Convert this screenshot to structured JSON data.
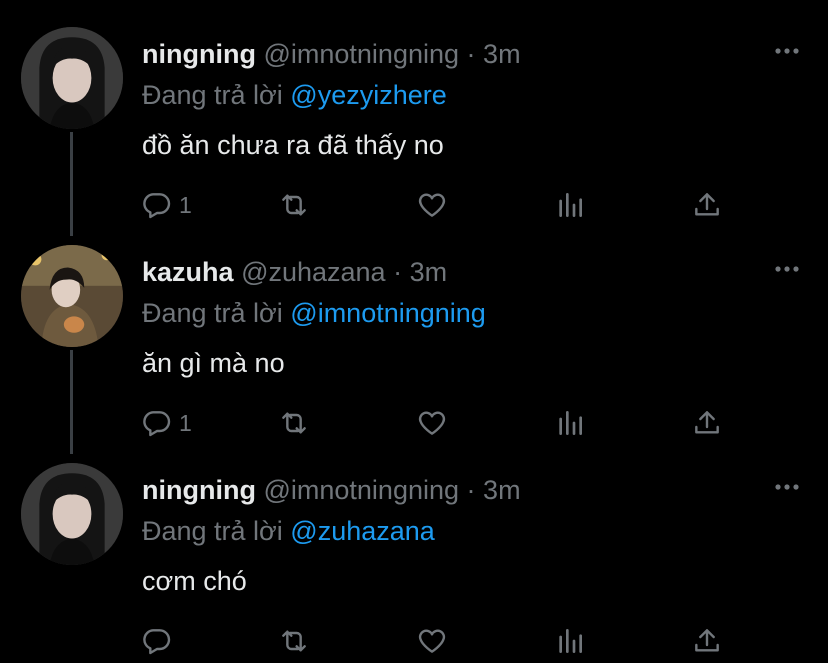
{
  "tweets": [
    {
      "name": "ningning",
      "handle": "@imnotningning",
      "dot": "·",
      "time": "3m",
      "reply_prefix": "Đang trả lời",
      "reply_to": "@yezyizhere",
      "text": "đồ ăn chưa ra đã thấy no",
      "reply_count": "1"
    },
    {
      "name": "kazuha",
      "handle": "@zuhazana",
      "dot": "·",
      "time": "3m",
      "reply_prefix": "Đang trả lời",
      "reply_to": "@imnotningning",
      "text": "ăn gì mà no",
      "reply_count": "1"
    },
    {
      "name": "ningning",
      "handle": "@imnotningning",
      "dot": "·",
      "time": "3m",
      "reply_prefix": "Đang trả lời",
      "reply_to": "@zuhazana",
      "text": "cơm chó",
      "reply_count": ""
    }
  ],
  "colors": {
    "background": "#000000",
    "text": "#e7e9ea",
    "secondary": "#71767b",
    "mention": "#1d9bf0",
    "thread_line": "#3a3f44"
  },
  "icons": [
    "reply-icon",
    "retweet-icon",
    "like-icon",
    "analytics-icon",
    "share-icon",
    "more-icon"
  ]
}
